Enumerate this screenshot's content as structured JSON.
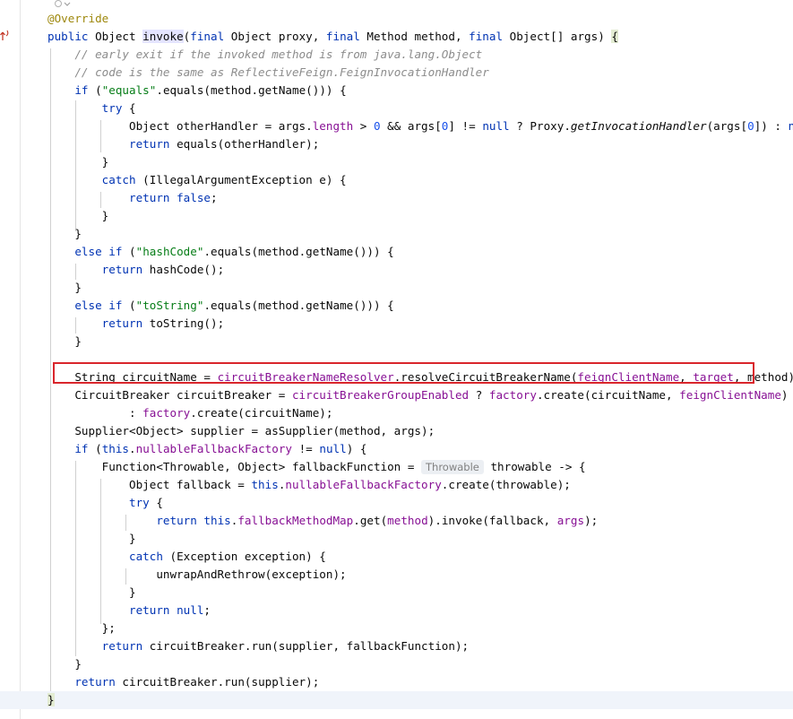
{
  "editor": {
    "language": "java",
    "lines": [
      [
        {
          "t": "@Override",
          "c": "ann"
        }
      ],
      [
        {
          "t": "public ",
          "c": "kw"
        },
        {
          "t": "Object "
        },
        {
          "t": "invoke",
          "c": "ident-hl"
        },
        {
          "t": "("
        },
        {
          "t": "final ",
          "c": "kw"
        },
        {
          "t": "Object proxy, "
        },
        {
          "t": "final ",
          "c": "kw"
        },
        {
          "t": "Method method, "
        },
        {
          "t": "final ",
          "c": "kw"
        },
        {
          "t": "Object[] args) "
        },
        {
          "t": "{",
          "c": "brace-hl"
        }
      ],
      [
        {
          "t": "    "
        },
        {
          "t": "// early exit if the invoked method is from java.lang.Object",
          "c": "com"
        }
      ],
      [
        {
          "t": "    "
        },
        {
          "t": "// code is the same as ReflectiveFeign.FeignInvocationHandler",
          "c": "com"
        }
      ],
      [
        {
          "t": "    "
        },
        {
          "t": "if ",
          "c": "kw"
        },
        {
          "t": "("
        },
        {
          "t": "\"equals\"",
          "c": "str"
        },
        {
          "t": ".equals(method.getName())) {"
        }
      ],
      [
        {
          "t": "        "
        },
        {
          "t": "try ",
          "c": "kw"
        },
        {
          "t": "{"
        }
      ],
      [
        {
          "t": "            Object otherHandler = args."
        },
        {
          "t": "length",
          "c": "field"
        },
        {
          "t": " > "
        },
        {
          "t": "0",
          "c": "num"
        },
        {
          "t": " && args["
        },
        {
          "t": "0",
          "c": "num"
        },
        {
          "t": "] != "
        },
        {
          "t": "null",
          "c": "kw"
        },
        {
          "t": " ? Proxy."
        },
        {
          "t": "getInvocationHandler",
          "c": "ital"
        },
        {
          "t": "(args["
        },
        {
          "t": "0",
          "c": "num"
        },
        {
          "t": "]) : "
        },
        {
          "t": "null",
          "c": "kw"
        },
        {
          "t": ";"
        }
      ],
      [
        {
          "t": "            "
        },
        {
          "t": "return ",
          "c": "kw"
        },
        {
          "t": "equals(otherHandler);"
        }
      ],
      [
        {
          "t": "        }"
        }
      ],
      [
        {
          "t": "        "
        },
        {
          "t": "catch ",
          "c": "kw"
        },
        {
          "t": "(IllegalArgumentException e) {"
        }
      ],
      [
        {
          "t": "            "
        },
        {
          "t": "return false",
          "c": "kw"
        },
        {
          "t": ";"
        }
      ],
      [
        {
          "t": "        }"
        }
      ],
      [
        {
          "t": "    }"
        }
      ],
      [
        {
          "t": "    "
        },
        {
          "t": "else if ",
          "c": "kw"
        },
        {
          "t": "("
        },
        {
          "t": "\"hashCode\"",
          "c": "str"
        },
        {
          "t": ".equals(method.getName())) {"
        }
      ],
      [
        {
          "t": "        "
        },
        {
          "t": "return ",
          "c": "kw"
        },
        {
          "t": "hashCode();"
        }
      ],
      [
        {
          "t": "    }"
        }
      ],
      [
        {
          "t": "    "
        },
        {
          "t": "else if ",
          "c": "kw"
        },
        {
          "t": "("
        },
        {
          "t": "\"toString\"",
          "c": "str"
        },
        {
          "t": ".equals(method.getName())) {"
        }
      ],
      [
        {
          "t": "        "
        },
        {
          "t": "return ",
          "c": "kw"
        },
        {
          "t": "toString();"
        }
      ],
      [
        {
          "t": "    }"
        }
      ],
      [],
      [
        {
          "t": "    String circuitName = "
        },
        {
          "t": "circuitBreakerNameResolver",
          "c": "field"
        },
        {
          "t": ".resolveCircuitBreakerName("
        },
        {
          "t": "feignClientName",
          "c": "field"
        },
        {
          "t": ", "
        },
        {
          "t": "target",
          "c": "field"
        },
        {
          "t": ", method);"
        }
      ],
      [
        {
          "t": "    CircuitBreaker circuitBreaker = "
        },
        {
          "t": "circuitBreakerGroupEnabled",
          "c": "field"
        },
        {
          "t": " ? "
        },
        {
          "t": "factory",
          "c": "field"
        },
        {
          "t": ".create(circuitName, "
        },
        {
          "t": "feignClientName",
          "c": "field"
        },
        {
          "t": ")"
        }
      ],
      [
        {
          "t": "            : "
        },
        {
          "t": "factory",
          "c": "field"
        },
        {
          "t": ".create(circuitName);"
        }
      ],
      [
        {
          "t": "    Supplier<Object> supplier = asSupplier(method, args);"
        }
      ],
      [
        {
          "t": "    "
        },
        {
          "t": "if ",
          "c": "kw"
        },
        {
          "t": "("
        },
        {
          "t": "this",
          "c": "kw"
        },
        {
          "t": "."
        },
        {
          "t": "nullableFallbackFactory",
          "c": "field"
        },
        {
          "t": " != "
        },
        {
          "t": "null",
          "c": "kw"
        },
        {
          "t": ") {"
        }
      ],
      [
        {
          "t": "        Function<Throwable, Object> fallbackFunction = "
        },
        {
          "t": "Throwable",
          "c": "hint"
        },
        {
          "t": " throwable -> {"
        }
      ],
      [
        {
          "t": "            Object fallback = "
        },
        {
          "t": "this",
          "c": "kw"
        },
        {
          "t": "."
        },
        {
          "t": "nullableFallbackFactory",
          "c": "field"
        },
        {
          "t": ".create(throwable);"
        }
      ],
      [
        {
          "t": "            "
        },
        {
          "t": "try ",
          "c": "kw"
        },
        {
          "t": "{"
        }
      ],
      [
        {
          "t": "                "
        },
        {
          "t": "return this",
          "c": "kw"
        },
        {
          "t": "."
        },
        {
          "t": "fallbackMethodMap",
          "c": "field"
        },
        {
          "t": ".get("
        },
        {
          "t": "method",
          "c": "field"
        },
        {
          "t": ").invoke(fallback, "
        },
        {
          "t": "args",
          "c": "field"
        },
        {
          "t": ");"
        }
      ],
      [
        {
          "t": "            }"
        }
      ],
      [
        {
          "t": "            "
        },
        {
          "t": "catch ",
          "c": "kw"
        },
        {
          "t": "(Exception exception) {"
        }
      ],
      [
        {
          "t": "                unwrapAndRethrow(exception);"
        }
      ],
      [
        {
          "t": "            }"
        }
      ],
      [
        {
          "t": "            "
        },
        {
          "t": "return null",
          "c": "kw"
        },
        {
          "t": ";"
        }
      ],
      [
        {
          "t": "        };"
        }
      ],
      [
        {
          "t": "        "
        },
        {
          "t": "return ",
          "c": "kw"
        },
        {
          "t": "circuitBreaker.run(supplier, fallbackFunction);"
        }
      ],
      [
        {
          "t": "    }"
        }
      ],
      [
        {
          "t": "    "
        },
        {
          "t": "return ",
          "c": "kw"
        },
        {
          "t": "circuitBreaker.run(supplier);"
        }
      ],
      [
        {
          "t": "}",
          "c": "brace-hl"
        }
      ]
    ],
    "highlighted_line": 20,
    "current_line": 38
  },
  "icons": {
    "gutter_override": "override-up-arrow-icon",
    "fold": "fold-toggle-icon"
  },
  "colors": {
    "keyword": "#0033b3",
    "field": "#871094",
    "string": "#067d17",
    "number": "#1750eb",
    "comment": "#8c8c8c",
    "annotation": "#9e880d",
    "highlight_box": "#d9262c"
  }
}
